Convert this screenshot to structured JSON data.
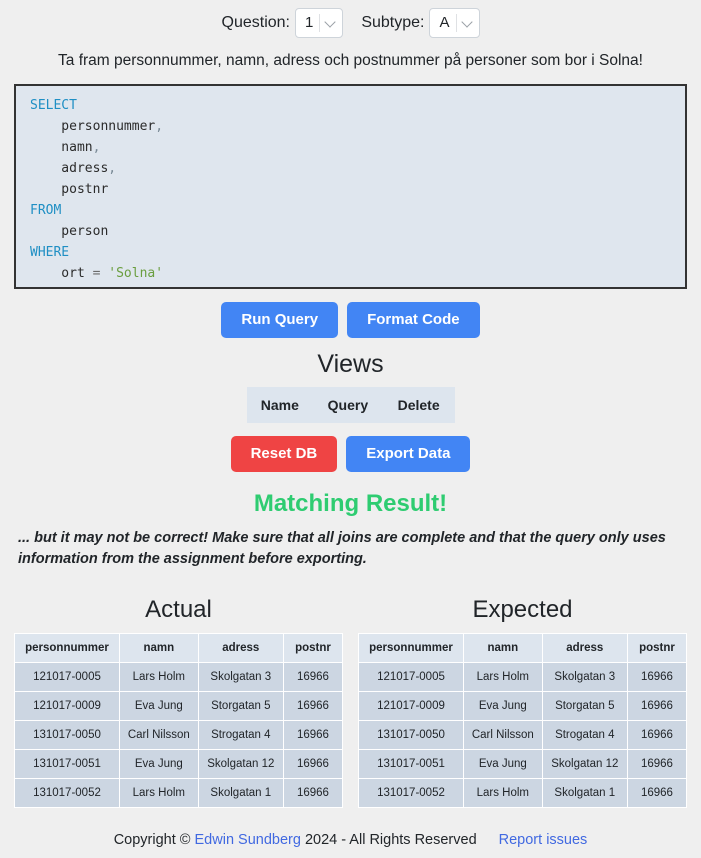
{
  "selector": {
    "question_label": "Question:",
    "question_value": "1",
    "subtype_label": "Subtype:",
    "subtype_value": "A",
    "chevron_icon": "chevron-down-icon"
  },
  "question_text": "Ta fram personnummer, namn, adress och postnummer på personer som bor i Solna!",
  "editor": {
    "lines": [
      {
        "segments": [
          {
            "t": "SELECT",
            "c": "kw"
          }
        ]
      },
      {
        "segments": [
          {
            "t": "    personnummer",
            "c": ""
          },
          {
            "t": ",",
            "c": "punc"
          }
        ]
      },
      {
        "segments": [
          {
            "t": "    namn",
            "c": ""
          },
          {
            "t": ",",
            "c": "punc"
          }
        ]
      },
      {
        "segments": [
          {
            "t": "    adress",
            "c": ""
          },
          {
            "t": ",",
            "c": "punc"
          }
        ]
      },
      {
        "segments": [
          {
            "t": "    postnr",
            "c": ""
          }
        ]
      },
      {
        "segments": [
          {
            "t": "FROM",
            "c": "kw"
          }
        ]
      },
      {
        "segments": [
          {
            "t": "    person",
            "c": ""
          }
        ]
      },
      {
        "segments": [
          {
            "t": "WHERE",
            "c": "kw"
          }
        ]
      },
      {
        "segments": [
          {
            "t": "    ort ",
            "c": ""
          },
          {
            "t": "=",
            "c": "op"
          },
          {
            "t": " ",
            "c": ""
          },
          {
            "t": "'Solna'",
            "c": "str"
          }
        ]
      }
    ]
  },
  "actions": {
    "run_query": "Run Query",
    "format_code": "Format Code",
    "reset_db": "Reset DB",
    "export_data": "Export Data"
  },
  "views": {
    "title": "Views",
    "columns": [
      "Name",
      "Query",
      "Delete"
    ],
    "rows": []
  },
  "result": {
    "status": "Matching Result!",
    "status_color": "#2ecc71",
    "note": "... but it may not be correct! Make sure that all joins are complete and that the query only uses information from the assignment before exporting."
  },
  "tables": {
    "actual": {
      "title": "Actual",
      "columns": [
        "personnummer",
        "namn",
        "adress",
        "postnr"
      ],
      "rows": [
        [
          "121017-0005",
          "Lars Holm",
          "Skolgatan 3",
          "16966"
        ],
        [
          "121017-0009",
          "Eva Jung",
          "Storgatan 5",
          "16966"
        ],
        [
          "131017-0050",
          "Carl Nilsson",
          "Strogatan 4",
          "16966"
        ],
        [
          "131017-0051",
          "Eva Jung",
          "Skolgatan 12",
          "16966"
        ],
        [
          "131017-0052",
          "Lars Holm",
          "Skolgatan 1",
          "16966"
        ]
      ]
    },
    "expected": {
      "title": "Expected",
      "columns": [
        "personnummer",
        "namn",
        "adress",
        "postnr"
      ],
      "rows": [
        [
          "121017-0005",
          "Lars Holm",
          "Skolgatan 3",
          "16966"
        ],
        [
          "121017-0009",
          "Eva Jung",
          "Storgatan 5",
          "16966"
        ],
        [
          "131017-0050",
          "Carl Nilsson",
          "Strogatan 4",
          "16966"
        ],
        [
          "131017-0051",
          "Eva Jung",
          "Skolgatan 12",
          "16966"
        ],
        [
          "131017-0052",
          "Lars Holm",
          "Skolgatan 1",
          "16966"
        ]
      ]
    }
  },
  "footer": {
    "copyright_prefix": "Copyright © ",
    "author": "Edwin Sundberg",
    "copyright_suffix": " 2024 - All Rights Reserved",
    "report_issues": "Report issues"
  },
  "colors": {
    "accent_blue": "#4285f4",
    "danger_red": "#ef4444",
    "success_green": "#2ecc71",
    "editor_bg": "#dfe6ee",
    "table_row_bg": "#ccd6e2",
    "table_head_bg": "#dde5ee"
  }
}
